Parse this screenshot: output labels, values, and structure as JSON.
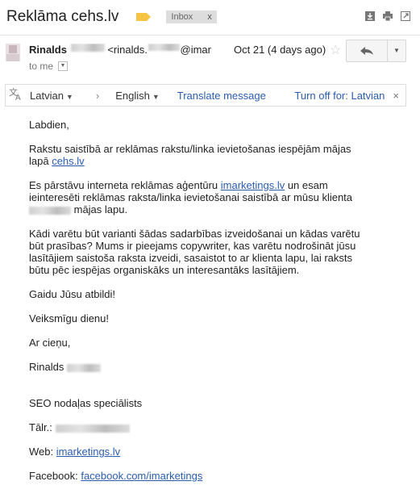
{
  "header": {
    "subject": "Reklāma cehs.lv",
    "label_chip": "Inbox",
    "label_chip_close": "x"
  },
  "icons": {
    "download": "download-icon",
    "print": "print-icon",
    "open_new_window": "new-window-icon",
    "star": "star-icon",
    "reply": "reply-icon",
    "more": "more-icon"
  },
  "message": {
    "sender_name": "Rinalds",
    "sender_email_prefix": "<rinalds.",
    "sender_email_suffix": "@imar",
    "to_text": "to me",
    "date": "Oct 21 (4 days ago)"
  },
  "translate_bar": {
    "source_lang": "Latvian",
    "target_lang": "English",
    "translate_link": "Translate message",
    "turn_off": "Turn off for: Latvian"
  },
  "email_body": {
    "greeting": "Labdien,",
    "p1_text": "Rakstu saistībā ar reklāmas rakstu/linka ievietošanas iespējām mājas lapā ",
    "p1_link": "cehs.lv",
    "p2_a": "Es pārstāvu interneta reklāmas aģentūru ",
    "p2_link": "imarketings.lv",
    "p2_b": " un esam ieinteresēti reklāmas raksta/linka ievietošanai saistībā ar mūsu klienta ",
    "p2_c": " mājas lapu.",
    "p3": "Kādi varētu būt varianti šādas sadarbības izveidošanai un kādas varētu būt prasības? Mums ir pieejams copywriter, kas varētu nodrošināt jūsu lasītājiem saistoša raksta izveidi, sasaistot to ar klienta lapu, lai raksts būtu pēc iespējas organiskāks un interesantāks lasītājiem.",
    "p4": "Gaidu Jūsu atbildi!",
    "p5": "Veiksmīgu dienu!",
    "p6": "Ar cieņu,",
    "sig_name": "Rinalds",
    "sig_title": "SEO nodaļas speciālists",
    "sig_phone_label": "Tālr.:",
    "sig_web_label": "Web: ",
    "sig_web_link": "imarketings.lv",
    "sig_fb_label": "Facebook: ",
    "sig_fb_link": "facebook.com/imarketings"
  }
}
